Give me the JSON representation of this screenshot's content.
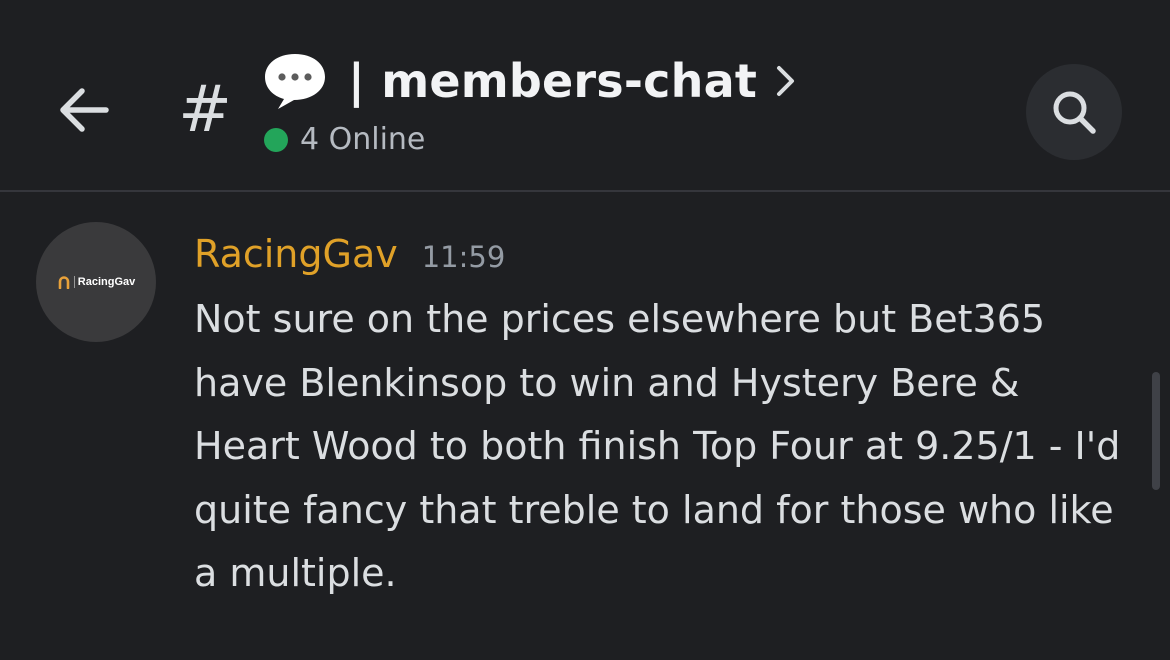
{
  "header": {
    "back_icon": "arrow-left-icon",
    "channel_icon": "hash-icon",
    "channel_emoji": "speech-balloon-icon",
    "channel_name": "| members-chat",
    "online_count_text": "4 Online",
    "search_icon": "search-icon"
  },
  "message": {
    "avatar_text": "RacingGav",
    "author": "RacingGav",
    "author_color": "#e0a128",
    "timestamp": "11:59",
    "text": "Not sure on the prices elsewhere but Bet365 have Blenkinsop to win and Hystery Bere & Heart Wood to both finish Top Four at 9.25/1 - I'd quite fancy that treble to land for those who like a multiple."
  },
  "colors": {
    "background": "#1e1f22",
    "online": "#23a55a",
    "text": "#dbdee1",
    "muted": "#949ba4"
  }
}
